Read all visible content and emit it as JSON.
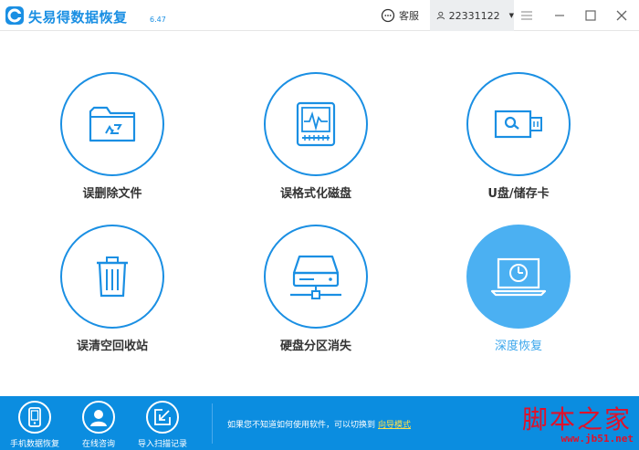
{
  "app": {
    "title": "失易得数据恢复",
    "version": "6.47"
  },
  "header": {
    "support_label": "客服",
    "user_id": "22331122"
  },
  "tiles": [
    {
      "label": "误删除文件",
      "icon": "deleted-files-folder-icon"
    },
    {
      "label": "误格式化磁盘",
      "icon": "formatted-disk-icon"
    },
    {
      "label": "U盘/储存卡",
      "icon": "usb-drive-icon"
    },
    {
      "label": "误清空回收站",
      "icon": "recycle-bin-icon"
    },
    {
      "label": "硬盘分区消失",
      "icon": "hard-drive-partition-icon"
    },
    {
      "label": "深度恢复",
      "icon": "deep-recovery-laptop-icon",
      "active": true
    }
  ],
  "bottom": {
    "items": [
      {
        "label": "手机数据恢复",
        "icon": "phone-icon"
      },
      {
        "label": "在线咨询",
        "icon": "consult-person-icon"
      },
      {
        "label": "导入扫描记录",
        "icon": "import-record-icon"
      }
    ],
    "hint_text": "如果您不知道如何使用软件，可以切换到",
    "hint_link": "向导模式"
  },
  "watermark": {
    "text": "脚本之家",
    "url": "www.jb51.net"
  },
  "colors": {
    "accent": "#1a8fe3",
    "active_fill": "#4bb0f2",
    "bottom_bar": "#0b8de0",
    "link": "#ffe14a",
    "watermark": "#e0112a"
  }
}
